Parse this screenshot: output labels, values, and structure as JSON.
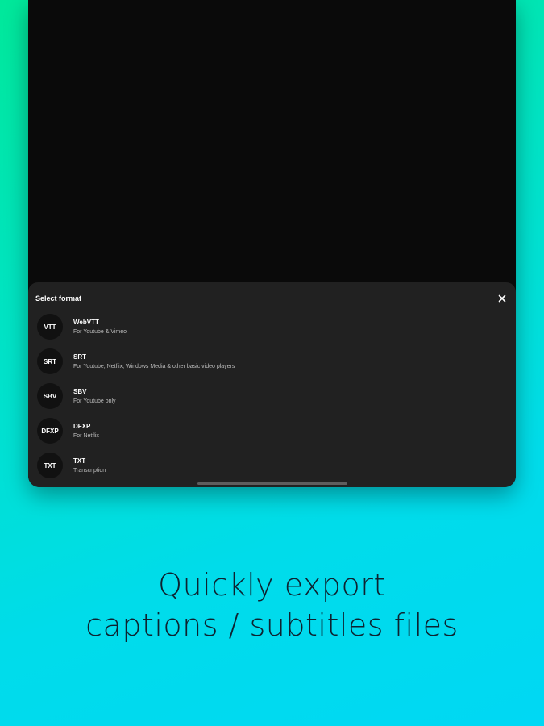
{
  "sheet": {
    "title": "Select format",
    "close_icon": "close-icon"
  },
  "formats": [
    {
      "badge": "VTT",
      "name": "WebVTT",
      "description": "For Youtube & Vimeo"
    },
    {
      "badge": "SRT",
      "name": "SRT",
      "description": "For Youtube, Netflix, Windows Media & other basic video players"
    },
    {
      "badge": "SBV",
      "name": "SBV",
      "description": "For Youtube only"
    },
    {
      "badge": "DFXP",
      "name": "DFXP",
      "description": "For Netflix"
    },
    {
      "badge": "TXT",
      "name": "TXT",
      "description": "Transcription"
    }
  ],
  "caption": {
    "line1": "Quickly export",
    "line2": "captions / subtitles files"
  },
  "colors": {
    "gradient_start": "#00e89a",
    "gradient_end": "#00d8f4",
    "sheet_bg": "#212121",
    "screen_bg": "#0a0a0a",
    "caption_text": "#0e2230"
  }
}
